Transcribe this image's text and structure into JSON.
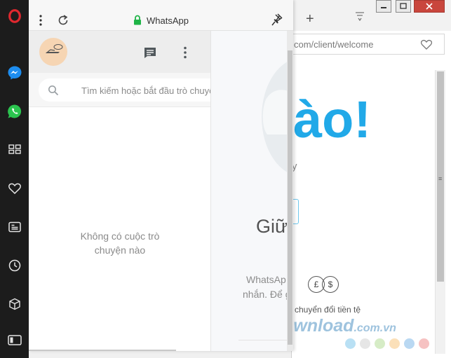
{
  "whatsapp": {
    "title": "WhatsApp",
    "search_placeholder": "Tìm kiếm hoặc bắt đầu trò chuyện",
    "empty_line1": "Không có cuộc trò",
    "empty_line2": "chuyện nào",
    "right_heading": "Giữ",
    "right_text_line1": "WhatsAp",
    "right_text_line2": "nhắn. Để g"
  },
  "background_page": {
    "url": "com/client/welcome",
    "headline": "ào!",
    "currency_label": "chuyển đổi tiền tệ",
    "currency_symbols": [
      "£",
      "$"
    ],
    "small_char": "y"
  },
  "watermark": {
    "text": "Download",
    "suffix": ".com.vn",
    "dot_colors": [
      "#b9e0f4",
      "#e6e6e6",
      "#d6ecc6",
      "#fbe0b9",
      "#b9d8f2",
      "#f6c2c2"
    ]
  },
  "colors": {
    "opera_red": "#e0282f",
    "whatsapp_green": "#1fb447",
    "accent_blue": "#21a9e8"
  }
}
